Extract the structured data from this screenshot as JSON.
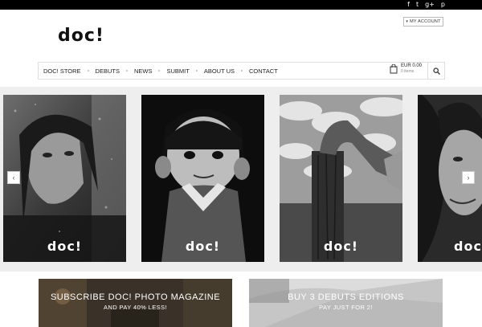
{
  "header": {
    "social_icons": [
      "facebook-icon",
      "twitter-icon",
      "google-plus-icon",
      "pinterest-icon"
    ],
    "social_glyphs": [
      "f",
      "t",
      "g+",
      "p"
    ],
    "account_label": "MY ACCOUNT",
    "logo_text": "doc!"
  },
  "nav": {
    "items": [
      "DOC! STORE",
      "DEBUTS",
      "NEWS",
      "SUBMIT",
      "ABOUT US",
      "CONTACT"
    ]
  },
  "cart": {
    "amount": "EUR 0.00",
    "items": "0 items"
  },
  "slider": {
    "overlay_logo": "doc!",
    "prev_arrow": "‹",
    "next_arrow": "›"
  },
  "promos": [
    {
      "title": "SUBSCRIBE DOC! PHOTO MAGAZINE",
      "subtitle": "AND PAY 40% LESS!"
    },
    {
      "title": "BUY 3 DEBUTS EDITIONS",
      "subtitle": "PAY JUST FOR 2!"
    }
  ]
}
